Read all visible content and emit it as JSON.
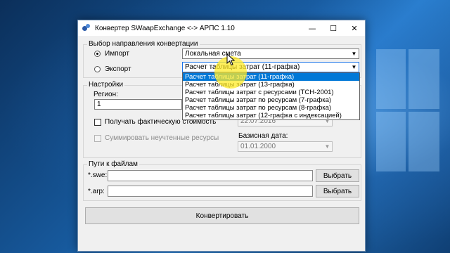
{
  "window": {
    "title": "Конвертер SWaapExchange <-> АРПС 1.10",
    "minimize_glyph": "—",
    "maximize_glyph": "☐",
    "close_glyph": "✕"
  },
  "direction_group": {
    "legend": "Выбор направления конвертации",
    "import_label": "Импорт",
    "export_label": "Экспорт",
    "selected": "import",
    "import_combo_value": "Локальная смета",
    "export_combo_value": "Расчет таблицы затрат (11-графка)"
  },
  "export_dropdown": {
    "open": true,
    "selected_index": 0,
    "options": [
      "Расчет таблицы затрат (11-графка)",
      "Расчет таблицы затрат (13-графка)",
      "Расчет таблицы затрат с ресурсами (ТСН-2001)",
      "Расчет таблицы затрат по ресурсам (7-графка)",
      "Расчет таблицы затрат по ресурсам (8-графка)",
      "Расчет таблицы затрат (12-графка с индексацией)"
    ]
  },
  "settings_group": {
    "legend": "Настройки",
    "region_label": "Регион:",
    "region_value": "1",
    "actual_cost_label": "Получать фактическую стоимость",
    "actual_cost_checked": false,
    "actual_cost_date": "22.07.2016",
    "sum_resources_label": "Суммировать неучтенные ресурсы",
    "sum_resources_checked": false,
    "base_date_label": "Базисная дата:",
    "base_date_value": "01.01.2000"
  },
  "paths_group": {
    "legend": "Пути к файлам",
    "swe_label": "*.swe:",
    "swe_value": "",
    "arp_label": "*.arp:",
    "arp_value": "",
    "browse_swe_label": "Выбрать",
    "browse_arp_label": "Выбрать"
  },
  "convert_button_label": "Конвертировать",
  "colors": {
    "selection": "#0078d7",
    "cursor_highlight": "#ffeb28",
    "desktop_blue": "#175a9e"
  },
  "icons": {
    "app": "app-icon",
    "dropdown": "chevron-down-icon",
    "cursor": "mouse-pointer-icon"
  }
}
